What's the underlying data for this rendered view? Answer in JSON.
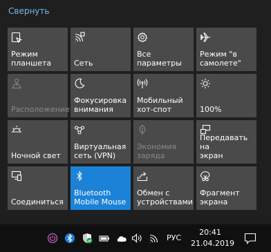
{
  "collapse_label": "Свернуть",
  "tiles": [
    {
      "label": "Режим\nпланшета",
      "icon": "tablet-mode-icon",
      "state": "off"
    },
    {
      "label": "Сеть",
      "icon": "network-icon",
      "state": "off"
    },
    {
      "label": "Все параметры",
      "icon": "settings-gear-icon",
      "state": "off"
    },
    {
      "label": "Режим \"в\nсамолете\"",
      "icon": "airplane-icon",
      "state": "off"
    },
    {
      "label": "Расположение",
      "icon": "location-icon",
      "state": "disabled"
    },
    {
      "label": "Фокусировка\nвнимания",
      "icon": "moon-icon",
      "state": "off"
    },
    {
      "label": "Мобильный\nхот-спот",
      "icon": "hotspot-icon",
      "state": "off"
    },
    {
      "label": "100%",
      "icon": "brightness-icon",
      "state": "off"
    },
    {
      "label": "Ночной свет",
      "icon": "night-light-icon",
      "state": "off"
    },
    {
      "label": "Виртуальная\nсеть (VPN)",
      "icon": "vpn-icon",
      "state": "off"
    },
    {
      "label": "Экономия\nзаряда",
      "icon": "battery-saver-leaf-icon",
      "state": "disabled"
    },
    {
      "label": "Передавать на\nэкран",
      "icon": "project-display-icon",
      "state": "off"
    },
    {
      "label": "Соединиться",
      "icon": "connect-devices-icon",
      "state": "off"
    },
    {
      "label": "Bluetooth\nMobile Mouse",
      "icon": "bluetooth-icon",
      "state": "on"
    },
    {
      "label": "Обмен с\nустройствами",
      "icon": "nearby-share-icon",
      "state": "off"
    },
    {
      "label": "Фрагмент\nэкрана",
      "icon": "screen-snip-icon",
      "state": "off"
    }
  ],
  "taskbar": {
    "tray_icons": [
      "power-app-icon",
      "bluetooth-icon",
      "defender-shield-icon",
      "battery-icon",
      "onedrive-cloud-icon",
      "volume-icon",
      "wifi-icon"
    ],
    "language": "РУС",
    "time": "20:41",
    "date": "21.04.2019",
    "notifications_icon": "notifications-icon"
  },
  "colors": {
    "background": "#1f1f1f",
    "tile": "#4a4a4a",
    "tile_active": "#1b82d7",
    "link": "#76b9ed",
    "taskbar": "#101010"
  }
}
